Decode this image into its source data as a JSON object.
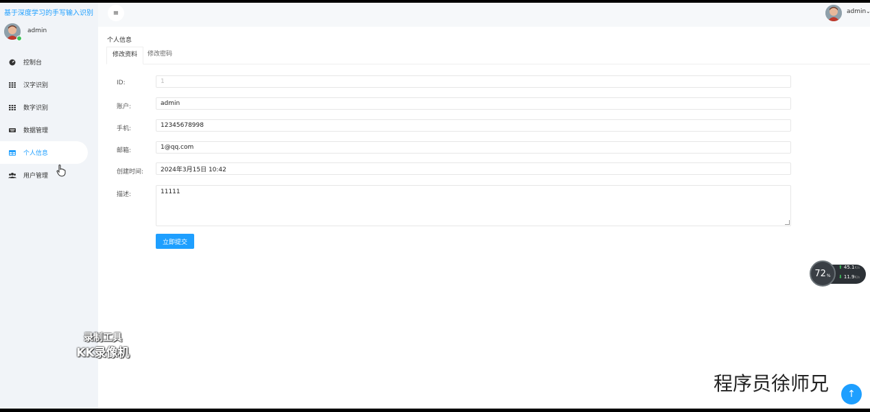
{
  "app": {
    "title": "基于深度学习的手写输入识别"
  },
  "sidebar": {
    "username": "admin",
    "items": [
      {
        "label": "控制台",
        "icon": "dashboard-icon",
        "active": false
      },
      {
        "label": "汉字识别",
        "icon": "grid-icon",
        "active": false
      },
      {
        "label": "数字识别",
        "icon": "grid-icon",
        "active": false
      },
      {
        "label": "数据管理",
        "icon": "keyboard-icon",
        "active": false
      },
      {
        "label": "个人信息",
        "icon": "table-icon",
        "active": true
      },
      {
        "label": "用户管理",
        "icon": "users-icon",
        "active": false
      }
    ]
  },
  "header": {
    "menu_icon": "≡",
    "username": "admin",
    "caret": "⌄"
  },
  "page": {
    "breadcrumb": "个人信息",
    "tabs": [
      {
        "label": "修改资料",
        "active": true
      },
      {
        "label": "修改密码",
        "active": false
      }
    ]
  },
  "form": {
    "id_label": "ID:",
    "id_value": "1",
    "account_label": "账户:",
    "account_value": "admin",
    "phone_label": "手机:",
    "phone_value": "12345678998",
    "email_label": "邮箱:",
    "email_value": "1@qq.com",
    "created_label": "创建时间:",
    "created_value": "2024年3月15日 10:42",
    "desc_label": "描述:",
    "desc_value": "11111",
    "submit_label": "立即提交"
  },
  "overlay": {
    "watermark_line1": "录制工具",
    "watermark_line2": "KK录像机",
    "speed_percent": "72",
    "speed_percent_unit": "%",
    "upload_value": "45.1",
    "upload_unit": "K/s",
    "download_value": "11.9",
    "download_unit": "K/s",
    "signature": "程序员徐师兄"
  },
  "colors": {
    "accent": "#1e9fff",
    "online": "#3cc35a"
  }
}
